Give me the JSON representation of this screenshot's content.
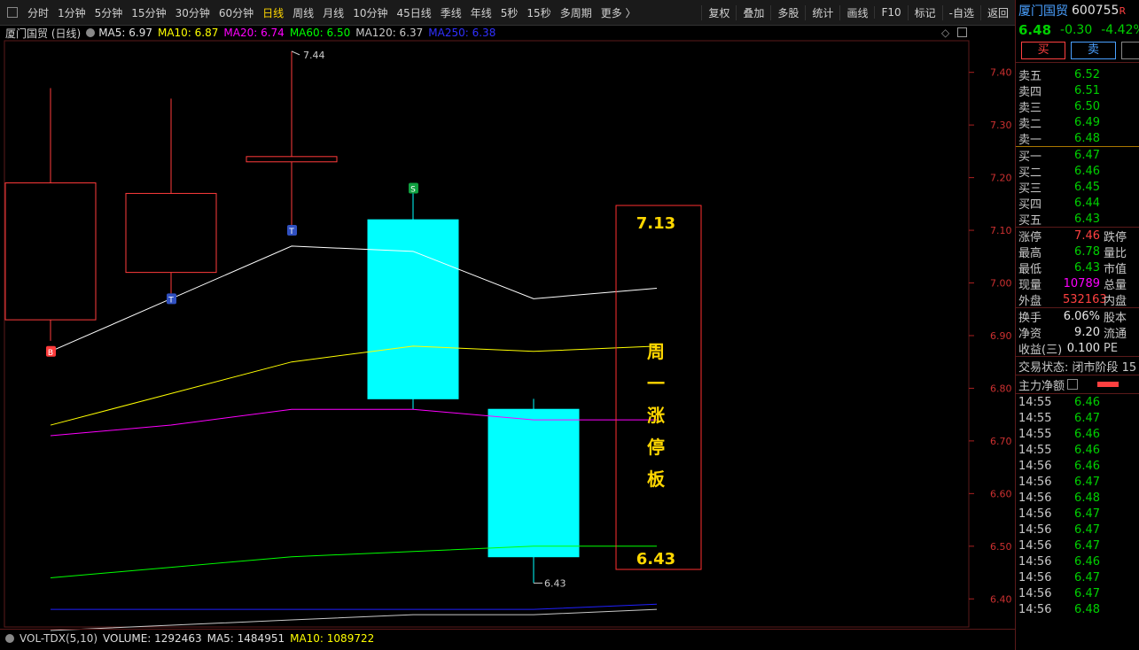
{
  "toolbar": {
    "periods": [
      "分时",
      "1分钟",
      "5分钟",
      "15分钟",
      "30分钟",
      "60分钟",
      "日线",
      "周线",
      "月线",
      "10分钟",
      "45日线",
      "季线",
      "年线",
      "5秒",
      "15秒",
      "多周期",
      "更多 〉"
    ],
    "active": "日线",
    "right": [
      "复权",
      "叠加",
      "多股",
      "统计",
      "画线",
      "F10",
      "标记",
      "-自选",
      "返回"
    ]
  },
  "chart_header": {
    "name": "厦门国贸 (日线)",
    "ma5": "MA5: 6.97",
    "ma10": "MA10: 6.87",
    "ma20": "MA20: 6.74",
    "ma60": "MA60: 6.50",
    "ma120": "MA120: 6.37",
    "ma250": "MA250: 6.38"
  },
  "colors": {
    "up": "#ff3b3b",
    "down": "#00ffff",
    "ma5": "#ffffff",
    "ma10": "#ffff00",
    "ma20": "#ff00ff",
    "ma60": "#00ff00",
    "ma120": "#c8c8c8",
    "ma250": "#2020ff",
    "annotation": "#ffd700"
  },
  "chart_data": {
    "type": "candlestick",
    "ylim": [
      6.35,
      7.46
    ],
    "yticks": [
      "7.40",
      "7.30",
      "7.20",
      "7.10",
      "7.00",
      "6.90",
      "6.80",
      "6.70",
      "6.60",
      "6.50",
      "6.40"
    ],
    "candles": [
      {
        "open": 6.93,
        "close": 7.19,
        "high": 7.37,
        "low": 6.89
      },
      {
        "open": 7.02,
        "close": 7.17,
        "high": 7.35,
        "low": 6.98
      },
      {
        "open": 7.23,
        "close": 7.24,
        "high": 7.44,
        "low": 7.11
      },
      {
        "open": 7.12,
        "close": 6.78,
        "high": 7.17,
        "low": 6.76
      },
      {
        "open": 6.76,
        "close": 6.48,
        "high": 6.78,
        "low": 6.43
      }
    ],
    "signals": [
      {
        "candle": 0,
        "label": "B",
        "color": "#ff3b3b",
        "value": 6.87
      },
      {
        "candle": 1,
        "label": "T",
        "color": "#3050c0",
        "value": 6.97
      },
      {
        "candle": 2,
        "label": "T",
        "color": "#3050c0",
        "value": 7.1
      },
      {
        "candle": 3,
        "label": "S",
        "color": "#10a040",
        "value": 7.18
      }
    ],
    "high_label": "7.44",
    "low_label": "6.43",
    "ma_lines": {
      "ma5": [
        6.87,
        6.97,
        7.07,
        7.06,
        6.97,
        6.99
      ],
      "ma10": [
        6.73,
        6.79,
        6.85,
        6.88,
        6.87,
        6.88
      ],
      "ma20": [
        6.71,
        6.73,
        6.76,
        6.76,
        6.74,
        6.74
      ],
      "ma60": [
        6.44,
        6.46,
        6.48,
        6.49,
        6.5,
        6.5
      ],
      "ma120": [
        6.34,
        6.35,
        6.36,
        6.37,
        6.37,
        6.38
      ],
      "ma250": [
        6.38,
        6.38,
        6.38,
        6.38,
        6.38,
        6.39
      ]
    }
  },
  "annotation": {
    "top": "7.13",
    "bottom": "6.43",
    "chars": [
      "周",
      "一",
      "涨",
      "停",
      "板"
    ]
  },
  "volume": {
    "name": "VOL-TDX(5,10)",
    "volume": "VOLUME: 1292463",
    "ma5": "MA5: 1484951",
    "ma10": "MA10: 1089722"
  },
  "quote": {
    "name": "厦门国贸",
    "code": "600755",
    "flag": "R",
    "price": "6.48",
    "change": "-0.30",
    "pct": "-4.42%",
    "buy_btn": "买",
    "sell_btn": "卖",
    "asks": [
      {
        "label": "卖五",
        "price": "6.52"
      },
      {
        "label": "卖四",
        "price": "6.51"
      },
      {
        "label": "卖三",
        "price": "6.50"
      },
      {
        "label": "卖二",
        "price": "6.49"
      },
      {
        "label": "卖一",
        "price": "6.48"
      }
    ],
    "bids": [
      {
        "label": "买一",
        "price": "6.47"
      },
      {
        "label": "买二",
        "price": "6.46"
      },
      {
        "label": "买三",
        "price": "6.45"
      },
      {
        "label": "买四",
        "price": "6.44"
      },
      {
        "label": "买五",
        "price": "6.43"
      }
    ],
    "stats": [
      {
        "label": "涨停",
        "value": "7.46",
        "color": "red",
        "extra": "跌停"
      },
      {
        "label": "最高",
        "value": "6.78",
        "color": "green",
        "extra": "量比"
      },
      {
        "label": "最低",
        "value": "6.43",
        "color": "green",
        "extra": "市值"
      },
      {
        "label": "现量",
        "value": "10789",
        "color": "magenta",
        "extra": "总量"
      },
      {
        "label": "外盘",
        "value": "532163",
        "color": "red",
        "extra": "内盘"
      }
    ],
    "stats2": [
      {
        "label": "换手",
        "value": "6.06%",
        "extra": "股本"
      },
      {
        "label": "净资",
        "value": "9.20",
        "extra": "流通"
      },
      {
        "label": "收益(三)",
        "value": "0.100",
        "extra": "PE"
      }
    ],
    "status": "交易状态: 闭市阶段 15",
    "main_flow": "主力净额",
    "ticks": [
      {
        "time": "14:55",
        "price": "6.46"
      },
      {
        "time": "14:55",
        "price": "6.47"
      },
      {
        "time": "14:55",
        "price": "6.46"
      },
      {
        "time": "14:55",
        "price": "6.46"
      },
      {
        "time": "14:56",
        "price": "6.46"
      },
      {
        "time": "14:56",
        "price": "6.47"
      },
      {
        "time": "14:56",
        "price": "6.48"
      },
      {
        "time": "14:56",
        "price": "6.47"
      },
      {
        "time": "14:56",
        "price": "6.47"
      },
      {
        "time": "14:56",
        "price": "6.47"
      },
      {
        "time": "14:56",
        "price": "6.46"
      },
      {
        "time": "14:56",
        "price": "6.47"
      },
      {
        "time": "14:56",
        "price": "6.47"
      },
      {
        "time": "14:56",
        "price": "6.48"
      }
    ]
  }
}
